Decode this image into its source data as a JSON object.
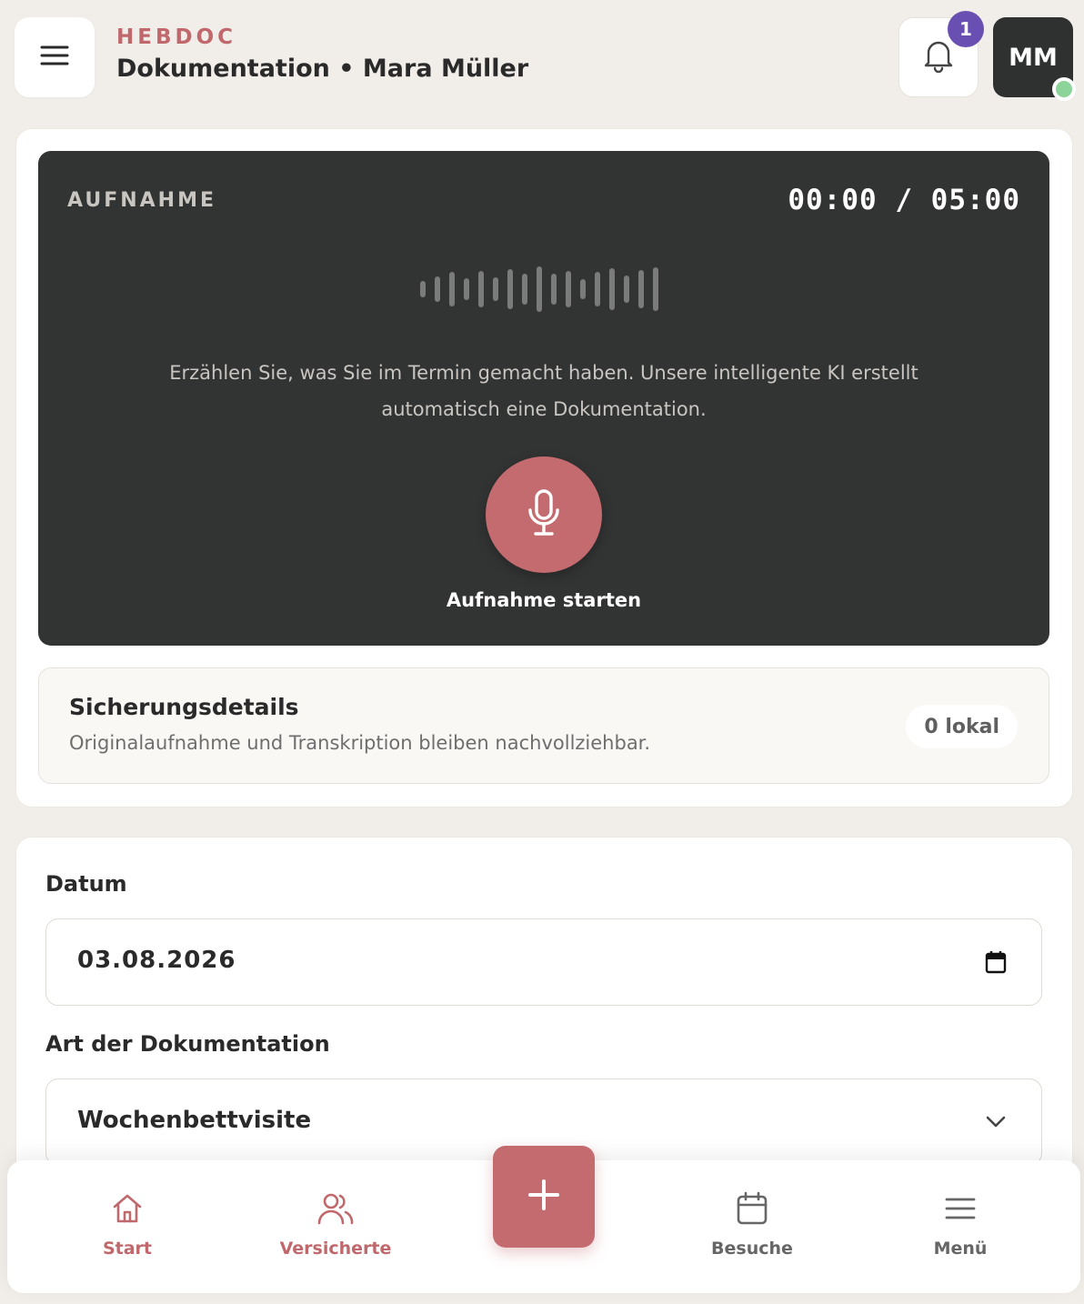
{
  "header": {
    "brand": "HEBDOC",
    "title": "Dokumentation • Mara Müller",
    "notification_count": "1",
    "avatar_initials": "MM"
  },
  "recording": {
    "label": "AUFNAHME",
    "timer": "00:00 / 05:00",
    "description": "Erzählen Sie, was Sie im Termin gemacht haben. Unsere intelligente KI erstellt automatisch eine Dokumentation.",
    "start_label": "Aufnahme starten",
    "accent_color": "#c46b70"
  },
  "backup": {
    "title": "Sicherungsdetails",
    "subtitle": "Originalaufnahme und Transkription bleiben nachvollziehbar.",
    "badge": "0 lokal"
  },
  "form": {
    "date_label": "Datum",
    "date_value": "03.08.2026",
    "type_label": "Art der Dokumentation",
    "type_value": "Wochenbettvisite"
  },
  "nav": {
    "items": [
      {
        "label": "Start",
        "icon": "home-icon",
        "active": true
      },
      {
        "label": "Versicherte",
        "icon": "users-icon",
        "active": false
      },
      {
        "label": "Besuche",
        "icon": "calendar-icon",
        "active": false
      },
      {
        "label": "Menü",
        "icon": "menu-icon",
        "active": false
      }
    ],
    "fab_icon": "plus-icon"
  },
  "colors": {
    "brand": "#c0686c",
    "badge": "#6a4fb3",
    "online": "#8dd49a",
    "dark_panel": "#323333"
  }
}
